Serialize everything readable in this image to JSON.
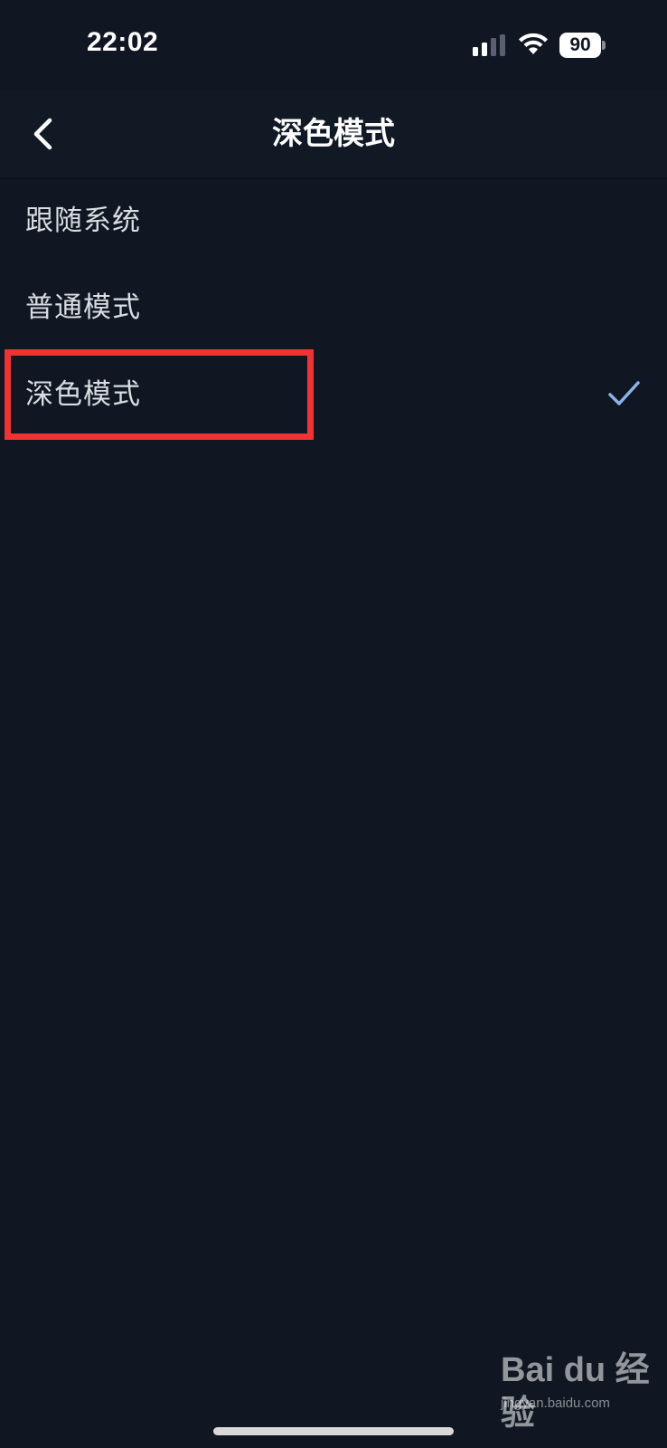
{
  "status_bar": {
    "time": "22:02",
    "battery_level": "90",
    "icons": [
      "signal-icon",
      "wifi-icon",
      "battery-icon"
    ]
  },
  "nav": {
    "back_icon": "chevron-left-icon",
    "title": "深色模式"
  },
  "options": [
    {
      "label": "跟随系统",
      "selected": false
    },
    {
      "label": "普通模式",
      "selected": false
    },
    {
      "label": "深色模式",
      "selected": true
    }
  ],
  "colors": {
    "background": "#101722",
    "nav_background": "#111925",
    "check": "#8ab4e8",
    "highlight": "#f23232",
    "text": "#d9dde2"
  },
  "watermark": {
    "logo": "Bai du 经验",
    "url": "jingyan.baidu.com"
  }
}
